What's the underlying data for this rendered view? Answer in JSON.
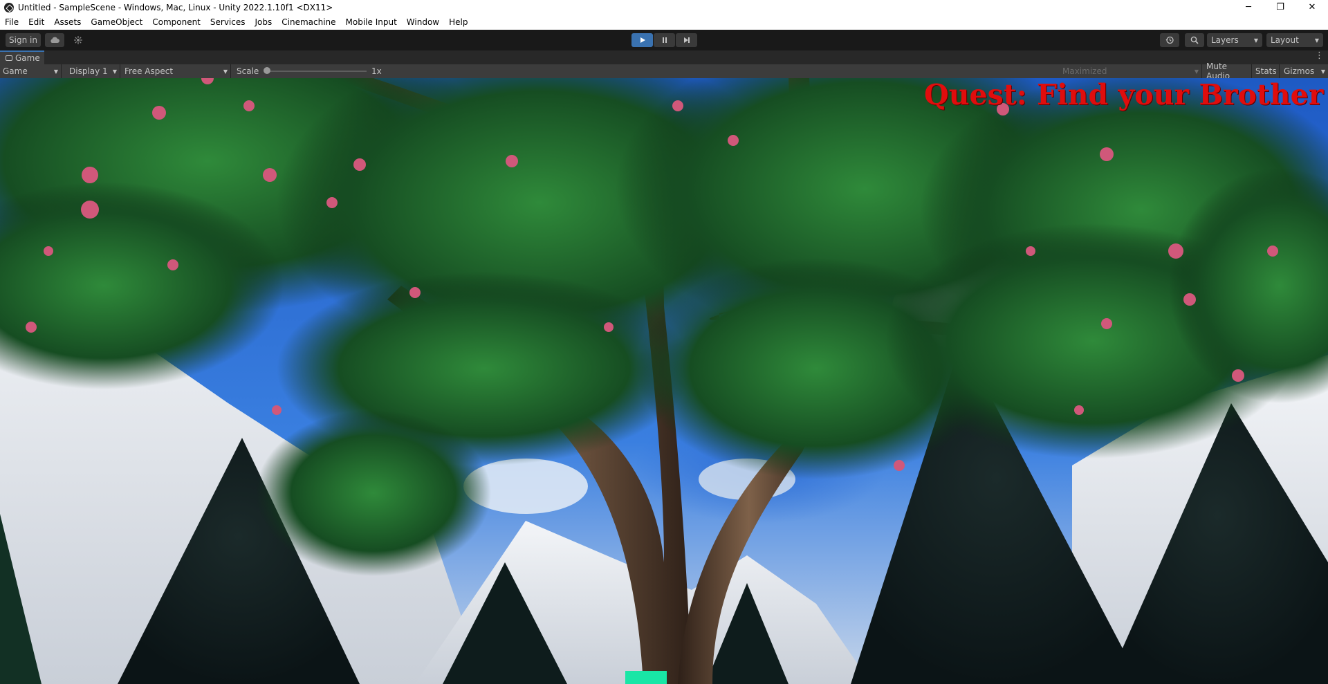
{
  "window": {
    "title": "Untitled - SampleScene - Windows, Mac, Linux - Unity 2022.1.10f1 <DX11>",
    "controls": {
      "minimize": "─",
      "maximize": "❐",
      "close": "✕"
    }
  },
  "menu": {
    "items": [
      "File",
      "Edit",
      "Assets",
      "GameObject",
      "Component",
      "Services",
      "Jobs",
      "Cinemachine",
      "Mobile Input",
      "Window",
      "Help"
    ]
  },
  "toolbar": {
    "sign_in": "Sign in",
    "layers": "Layers",
    "layout": "Layout",
    "play_state": "playing"
  },
  "tab": {
    "label": "Game"
  },
  "game_bar": {
    "view_mode": "Game",
    "display": "Display 1",
    "aspect": "Free Aspect",
    "scale_label": "Scale",
    "scale_value": "1x",
    "scale_fraction": 0.0,
    "maximized": "Maximized",
    "mute_audio": "Mute Audio",
    "stats": "Stats",
    "gizmos": "Gizmos"
  },
  "hud": {
    "quest_text": "Quest: Find your Brother",
    "quest_color": "#e00d0d",
    "health_color": "#19e6a6"
  },
  "colors": {
    "play_active": "#3a72b0",
    "toolbar_bg": "#191919",
    "panel_bg": "#3c3c3c"
  }
}
